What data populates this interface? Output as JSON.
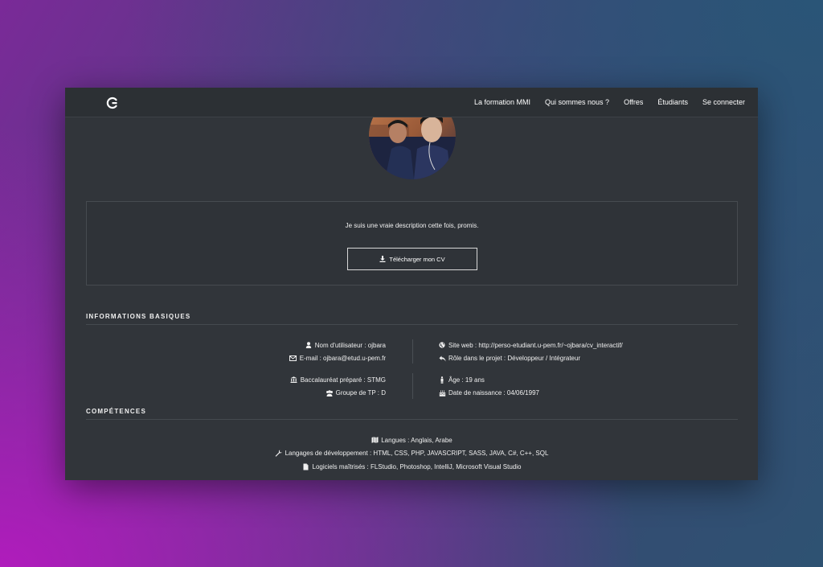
{
  "nav": {
    "logo": "logo-icon",
    "links": [
      "La formation MMI",
      "Qui sommes nous ?",
      "Offres",
      "Étudiants",
      "Se connecter"
    ]
  },
  "profile": {
    "description": "Je suis une vraie description cette fois, promis.",
    "cv_button": "Télécharger mon CV"
  },
  "basic_info": {
    "title": "INFORMATIONS BASIQUES",
    "username": "Nom d'utilisateur : ojbara",
    "email": "E-mail : ojbara@etud.u-pem.fr",
    "website": "Site web : http://perso-etudiant.u-pem.fr/~ojbara/cv_interactif/",
    "role": "Rôle dans le projet : Développeur / Intégrateur",
    "bac": "Baccalauréat préparé : STMG",
    "group": "Groupe de TP : D",
    "age": "Âge : 19 ans",
    "birthdate": "Date de naissance : 04/06/1997"
  },
  "skills": {
    "title": "COMPÉTENCES",
    "languages": "Langues : Anglais, Arabe",
    "dev_languages": "Langages de développement : HTML, CSS, PHP, JAVASCRIPT, SASS, JAVA, C#, C++, SQL",
    "software": "Logiciels maîtrisés : FLStudio, Photoshop, IntelliJ, Microsoft Visual Studio"
  }
}
